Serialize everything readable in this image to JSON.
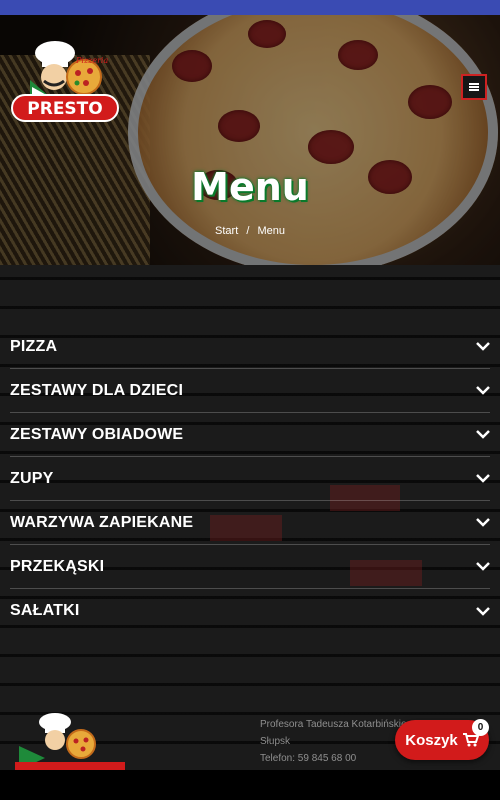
{
  "brand": {
    "logo_text": "PRESTO",
    "logo_subtext": "Pizzeria"
  },
  "hero": {
    "title": "Menu",
    "breadcrumb": [
      {
        "label": "Start"
      },
      {
        "label": "Menu"
      }
    ],
    "breadcrumb_separator": "/"
  },
  "categories": [
    {
      "label": "PIZZA",
      "icon": "chevron-down-icon"
    },
    {
      "label": "ZESTAWY DLA DZIECI",
      "icon": "chevron-down-icon"
    },
    {
      "label": "ZESTAWY OBIADOWE",
      "icon": "chevron-down-icon"
    },
    {
      "label": "ZUPY",
      "icon": "chevron-down-icon"
    },
    {
      "label": "WARZYWA ZAPIEKANE",
      "icon": "chevron-down-icon"
    },
    {
      "label": "PRZEKĄSKI",
      "icon": "chevron-down-icon"
    },
    {
      "label": "SAŁATKI",
      "icon": "chevron-down-icon"
    }
  ],
  "footer": {
    "address_line1": "Profesora Tadeusza Kotarbińskiego",
    "address_line2": "Słupsk",
    "phone": "Telefon: 59 845 68 00"
  },
  "cart": {
    "label": "Koszyk",
    "count": "0"
  },
  "colors": {
    "accent_red": "#d21b1b",
    "title_glow_green": "#0b7a2c",
    "top_strip_blue": "#3a4bb3"
  }
}
